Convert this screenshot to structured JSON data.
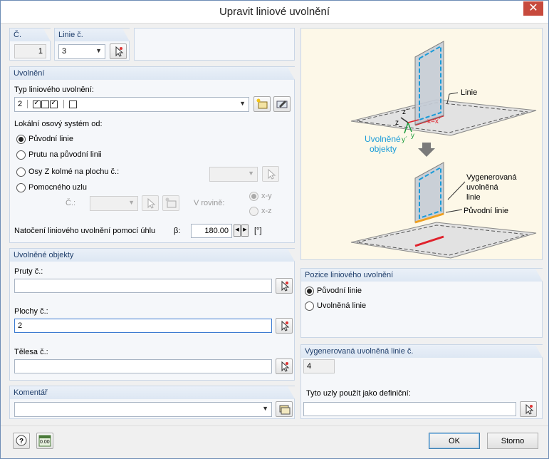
{
  "window": {
    "title": "Upravit liniové uvolnění",
    "close": "✕"
  },
  "top": {
    "no_label": "Č.",
    "no_value": "1",
    "line_label": "Linie č.",
    "line_value": "3"
  },
  "release": {
    "header": "Uvolnění",
    "type_label": "Typ liniového uvolnění:",
    "type_number": "2",
    "lcs_label": "Lokální osový systém od:",
    "opt_original": "Původní linie",
    "opt_member": "Prutu na původní linii",
    "opt_zaxis": "Osy Z kolmé na plochu č.:",
    "opt_helpnode": "Pomocného uzlu",
    "node_no_label": "Č.:",
    "plane_label": "V rovině:",
    "plane_xy": "x-y",
    "plane_xz": "x-z",
    "rotation_label": "Natočení liniového uvolnění pomocí úhlu",
    "beta_label": "β:",
    "beta_value": "180.00",
    "unit": "[°]"
  },
  "released": {
    "header": "Uvolněné objekty",
    "members_label": "Pruty č.:",
    "members_value": "",
    "surfaces_label": "Plochy č.:",
    "surfaces_value": "2",
    "solids_label": "Tělesa č.:",
    "solids_value": ""
  },
  "comment": {
    "header": "Komentář",
    "value": ""
  },
  "diagram": {
    "linie": "Linie",
    "x_eq": "x=x´",
    "z_prime": "z´",
    "z": "z",
    "y_prime": "y´",
    "y": "y",
    "released_objects_1": "Uvolněné",
    "released_objects_2": "objekty",
    "generated_1": "Vygenerovaná",
    "generated_2": "uvolněná",
    "generated_3": "linie",
    "original_line": "Původní linie"
  },
  "position": {
    "header": "Pozice liniového uvolnění",
    "opt_original": "Původní linie",
    "opt_released": "Uvolněná linie"
  },
  "generated": {
    "header": "Vygenerovaná uvolněná linie č.",
    "value": "4",
    "nodes_label": "Tyto uzly použít jako definiční:",
    "nodes_value": ""
  },
  "footer": {
    "ok": "OK",
    "cancel": "Storno",
    "units_icon": "0.00"
  },
  "colors": {
    "accent": "#1f3e6b",
    "close": "#c74a3d",
    "diagram_bg": "#fdf8e8",
    "cyan": "#1a9bd8",
    "red": "#e0212b",
    "orange": "#f0a020"
  }
}
